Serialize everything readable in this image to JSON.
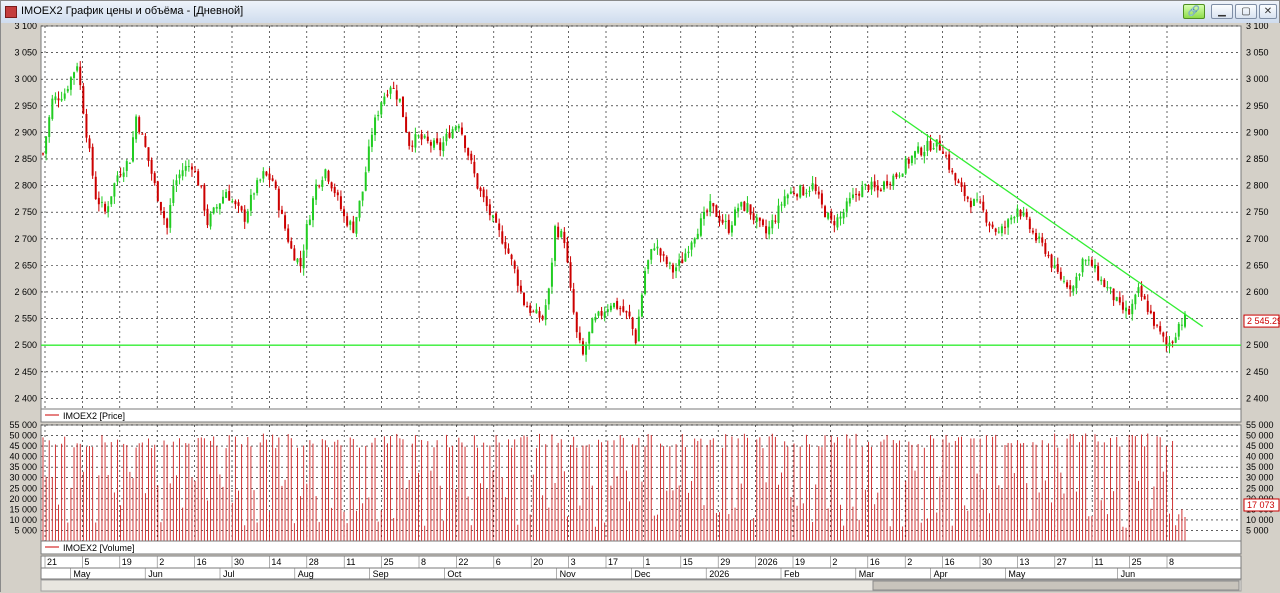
{
  "window": {
    "title": "IMOEX2 График цены и объёма - [Дневной]",
    "buttons": {
      "link": "🔗",
      "minimize": "▁",
      "maximize": "▢",
      "close": "✕"
    }
  },
  "colors": {
    "bull": "#22cc22",
    "bear": "#cc0000",
    "trendline": "#33ee33",
    "volume": "#cc2222",
    "grid": "#000000",
    "price_box_border": "#cc0000"
  },
  "chart_data": [
    {
      "type": "candlestick",
      "legend": "IMOEX2 [Price]",
      "ylim": [
        2380,
        3100
      ],
      "y_ticks": [
        "3 100",
        "3 050",
        "3 000",
        "2 950",
        "2 900",
        "2 850",
        "2 800",
        "2 750",
        "2 700",
        "2 650",
        "2 600",
        "2 550",
        "2 500",
        "2 450",
        "2 400"
      ],
      "last_price": "2 545.29",
      "support_line": {
        "y": 2500
      },
      "trend_line": {
        "start": {
          "date": "2026-03-02",
          "y": 2940
        },
        "end": {
          "date": "2026-06-15",
          "y": 2535
        }
      },
      "approx_path": [
        [
          0,
          2860
        ],
        [
          3,
          2960
        ],
        [
          7,
          2975
        ],
        [
          11,
          3030
        ],
        [
          14,
          2900
        ],
        [
          17,
          2780
        ],
        [
          20,
          2750
        ],
        [
          24,
          2820
        ],
        [
          28,
          2850
        ],
        [
          30,
          2930
        ],
        [
          33,
          2870
        ],
        [
          36,
          2800
        ],
        [
          38,
          2760
        ],
        [
          40,
          2720
        ],
        [
          42,
          2800
        ],
        [
          45,
          2830
        ],
        [
          48,
          2840
        ],
        [
          51,
          2790
        ],
        [
          53,
          2730
        ],
        [
          56,
          2760
        ],
        [
          59,
          2790
        ],
        [
          62,
          2760
        ],
        [
          65,
          2740
        ],
        [
          68,
          2790
        ],
        [
          71,
          2820
        ],
        [
          74,
          2810
        ],
        [
          77,
          2740
        ],
        [
          80,
          2680
        ],
        [
          83,
          2650
        ],
        [
          85,
          2720
        ],
        [
          88,
          2800
        ],
        [
          91,
          2830
        ],
        [
          94,
          2790
        ],
        [
          97,
          2740
        ],
        [
          100,
          2720
        ],
        [
          103,
          2790
        ],
        [
          106,
          2900
        ],
        [
          109,
          2960
        ],
        [
          112,
          2990
        ],
        [
          115,
          2960
        ],
        [
          118,
          2880
        ],
        [
          121,
          2890
        ],
        [
          124,
          2880
        ],
        [
          128,
          2870
        ],
        [
          131,
          2900
        ],
        [
          134,
          2920
        ],
        [
          137,
          2860
        ],
        [
          140,
          2800
        ],
        [
          143,
          2760
        ],
        [
          146,
          2720
        ],
        [
          149,
          2690
        ],
        [
          152,
          2640
        ],
        [
          155,
          2580
        ],
        [
          158,
          2560
        ],
        [
          161,
          2550
        ],
        [
          163,
          2600
        ],
        [
          165,
          2720
        ],
        [
          168,
          2700
        ],
        [
          170,
          2600
        ],
        [
          172,
          2520
        ],
        [
          174,
          2480
        ],
        [
          177,
          2540
        ],
        [
          180,
          2560
        ],
        [
          183,
          2580
        ],
        [
          186,
          2570
        ],
        [
          189,
          2550
        ],
        [
          191,
          2510
        ],
        [
          194,
          2640
        ],
        [
          197,
          2690
        ],
        [
          200,
          2660
        ],
        [
          203,
          2640
        ],
        [
          206,
          2660
        ],
        [
          209,
          2700
        ],
        [
          212,
          2730
        ],
        [
          215,
          2760
        ],
        [
          218,
          2740
        ],
        [
          221,
          2720
        ],
        [
          224,
          2760
        ],
        [
          227,
          2760
        ],
        [
          230,
          2730
        ],
        [
          233,
          2710
        ],
        [
          236,
          2740
        ],
        [
          239,
          2780
        ],
        [
          242,
          2790
        ],
        [
          245,
          2790
        ],
        [
          248,
          2800
        ],
        [
          251,
          2760
        ],
        [
          254,
          2730
        ],
        [
          257,
          2740
        ],
        [
          260,
          2770
        ],
        [
          263,
          2790
        ],
        [
          266,
          2800
        ],
        [
          269,
          2790
        ],
        [
          272,
          2810
        ],
        [
          275,
          2820
        ],
        [
          278,
          2840
        ],
        [
          281,
          2860
        ],
        [
          284,
          2870
        ],
        [
          287,
          2880
        ],
        [
          290,
          2870
        ],
        [
          293,
          2820
        ],
        [
          296,
          2790
        ],
        [
          299,
          2770
        ],
        [
          302,
          2760
        ],
        [
          305,
          2730
        ],
        [
          308,
          2710
        ],
        [
          311,
          2730
        ],
        [
          314,
          2760
        ],
        [
          317,
          2730
        ],
        [
          320,
          2700
        ],
        [
          323,
          2680
        ],
        [
          326,
          2640
        ],
        [
          329,
          2620
        ],
        [
          332,
          2610
        ],
        [
          335,
          2660
        ],
        [
          338,
          2650
        ],
        [
          341,
          2620
        ],
        [
          344,
          2600
        ],
        [
          347,
          2570
        ],
        [
          350,
          2560
        ],
        [
          353,
          2600
        ],
        [
          356,
          2570
        ],
        [
          359,
          2530
        ],
        [
          362,
          2500
        ],
        [
          364,
          2510
        ],
        [
          366,
          2540
        ],
        [
          368,
          2550
        ]
      ],
      "x_ticks_days": [
        "21",
        "5",
        "19",
        "2",
        "16",
        "30",
        "14",
        "28",
        "11",
        "25",
        "8",
        "22",
        "6",
        "20",
        "3",
        "17",
        "1",
        "15",
        "29",
        "2026",
        "19",
        "2",
        "16",
        "2",
        "16",
        "30",
        "13",
        "27",
        "11",
        "25",
        "8"
      ],
      "x_ticks_months": [
        "May",
        "Jun",
        "Jul",
        "Aug",
        "Sep",
        "Oct",
        "Nov",
        "Dec",
        "2026",
        "Feb",
        "Mar",
        "Apr",
        "May",
        "Jun"
      ]
    },
    {
      "type": "bar",
      "legend": "IMOEX2 [Volume]",
      "ylim": [
        0,
        55000
      ],
      "y_ticks": [
        "55 000",
        "50 000",
        "45 000",
        "40 000",
        "35 000",
        "30 000",
        "25 000",
        "20 000",
        "15 000",
        "10 000",
        "5 000"
      ],
      "last_volume": "17 073",
      "typical_peak": 50000
    }
  ]
}
